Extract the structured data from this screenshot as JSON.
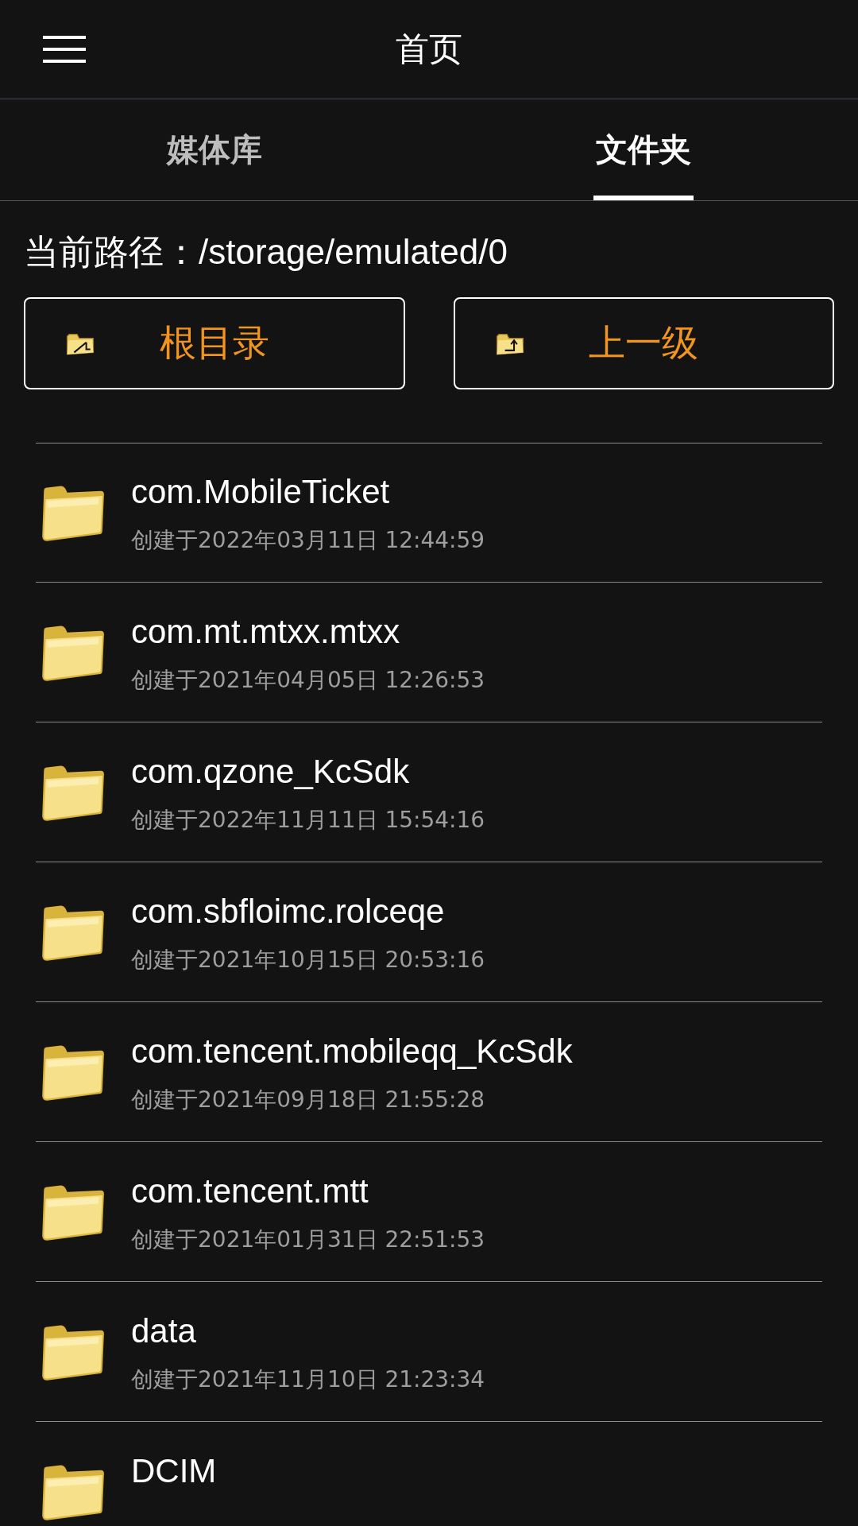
{
  "header": {
    "title": "首页"
  },
  "tabs": [
    {
      "label": "媒体库",
      "selected": false
    },
    {
      "label": "文件夹",
      "selected": true
    }
  ],
  "path": {
    "label": "当前路径：/storage/emulated/0"
  },
  "buttons": [
    {
      "label": "根目录",
      "kind": "root"
    },
    {
      "label": "上一级",
      "kind": "up"
    }
  ],
  "folders": [
    {
      "name": "com.MobileTicket",
      "date": "创建于2022年03月11日 12:44:59"
    },
    {
      "name": "com.mt.mtxx.mtxx",
      "date": "创建于2021年04月05日 12:26:53"
    },
    {
      "name": "com.qzone_KcSdk",
      "date": "创建于2022年11月11日 15:54:16"
    },
    {
      "name": "com.sbfloimc.rolceqe",
      "date": "创建于2021年10月15日 20:53:16"
    },
    {
      "name": "com.tencent.mobileqq_KcSdk",
      "date": "创建于2021年09月18日 21:55:28"
    },
    {
      "name": "com.tencent.mtt",
      "date": "创建于2021年01月31日 22:51:53"
    },
    {
      "name": "data",
      "date": "创建于2021年11月10日 21:23:34"
    },
    {
      "name": "DCIM"
    }
  ]
}
